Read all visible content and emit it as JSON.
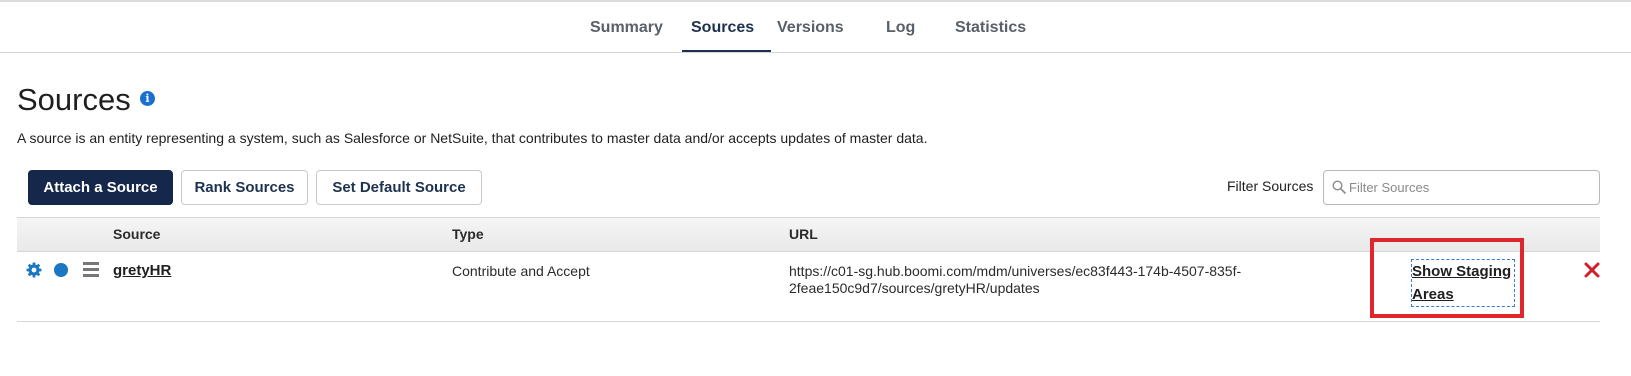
{
  "tabs": [
    {
      "label": "Summary",
      "active": false
    },
    {
      "label": "Sources",
      "active": true
    },
    {
      "label": "Versions",
      "active": false
    },
    {
      "label": "Log",
      "active": false
    },
    {
      "label": "Statistics",
      "active": false
    }
  ],
  "page": {
    "title": "Sources",
    "info_icon": "info-icon",
    "description": "A source is an entity representing a system, such as Salesforce or NetSuite, that contributes to master data and/or accepts updates of master data."
  },
  "toolbar": {
    "attach_label": "Attach a Source",
    "rank_label": "Rank Sources",
    "default_label": "Set Default Source",
    "filter_label": "Filter Sources",
    "filter_placeholder": "Filter Sources",
    "filter_value": ""
  },
  "table": {
    "columns": [
      "Source",
      "Type",
      "URL"
    ],
    "rows": [
      {
        "source": "gretyHR",
        "type": "Contribute and Accept",
        "url": "https://c01-sg.hub.boomi.com/mdm/universes/ec83f443-174b-4507-835f-2feae150c9d7/sources/gretyHR/updates",
        "staging_label": "Show Staging Areas",
        "icons": [
          "gear-icon",
          "status-dot-icon",
          "drag-handle-icon",
          "delete-icon"
        ]
      }
    ]
  },
  "colors": {
    "primary": "#15274a",
    "accent": "#1a78c2",
    "highlight": "#e0262a",
    "delete": "#d0202a"
  }
}
